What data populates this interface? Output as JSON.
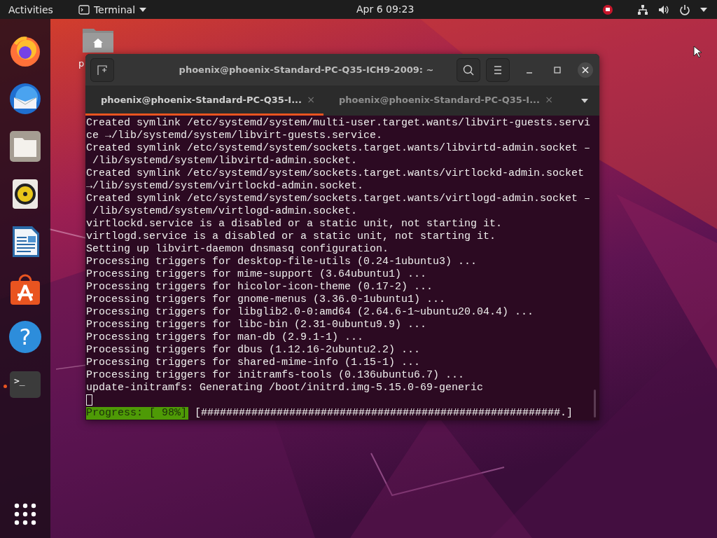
{
  "top_bar": {
    "activities": "Activities",
    "app_menu": "Terminal",
    "clock": "Apr 6  09:23"
  },
  "dock": {
    "items": [
      {
        "kind": "firefox",
        "running": false
      },
      {
        "kind": "mail",
        "running": false
      },
      {
        "kind": "files",
        "running": false
      },
      {
        "kind": "speaker",
        "running": false
      },
      {
        "kind": "writer",
        "running": false
      },
      {
        "kind": "software",
        "running": false
      },
      {
        "kind": "help",
        "glyph": "?",
        "running": false
      },
      {
        "kind": "terminal",
        "glyph": ">_",
        "running": true
      }
    ]
  },
  "desktop_icons": [
    {
      "label": "p"
    }
  ],
  "terminal": {
    "title": "phoenix@phoenix-Standard-PC-Q35-ICH9-2009: ~",
    "tabs": [
      {
        "label": "phoenix@phoenix-Standard-PC-Q35-I...",
        "close": "×",
        "selected": true
      },
      {
        "label": "phoenix@phoenix-Standard-PC-Q35-I...",
        "close": "×",
        "selected": false
      }
    ],
    "lines": [
      "Created symlink /etc/systemd/system/multi-user.target.wants/libvirt-guests.servi",
      "ce →/lib/systemd/system/libvirt-guests.service.",
      "Created symlink /etc/systemd/system/sockets.target.wants/libvirtd-admin.socket –",
      " /lib/systemd/system/libvirtd-admin.socket.",
      "Created symlink /etc/systemd/system/sockets.target.wants/virtlockd-admin.socket",
      "→/lib/systemd/system/virtlockd-admin.socket.",
      "Created symlink /etc/systemd/system/sockets.target.wants/virtlogd-admin.socket –",
      " /lib/systemd/system/virtlogd-admin.socket.",
      "virtlockd.service is a disabled or a static unit, not starting it.",
      "virtlogd.service is a disabled or a static unit, not starting it.",
      "Setting up libvirt-daemon dnsmasq configuration.",
      "Processing triggers for desktop-file-utils (0.24-1ubuntu3) ...",
      "Processing triggers for mime-support (3.64ubuntu1) ...",
      "Processing triggers for hicolor-icon-theme (0.17-2) ...",
      "Processing triggers for gnome-menus (3.36.0-1ubuntu1) ...",
      "Processing triggers for libglib2.0-0:amd64 (2.64.6-1~ubuntu20.04.4) ...",
      "Processing triggers for libc-bin (2.31-0ubuntu9.9) ...",
      "Processing triggers for man-db (2.9.1-1) ...",
      "Processing triggers for dbus (1.12.16-2ubuntu2.2) ...",
      "Processing triggers for shared-mime-info (1.15-1) ...",
      "Processing triggers for initramfs-tools (0.136ubuntu6.7) ...",
      "update-initramfs: Generating /boot/initrd.img-5.15.0-69-generic"
    ],
    "progress": {
      "label": "Progress: [ 98%]",
      "bar": "[#########################################################.]"
    }
  }
}
